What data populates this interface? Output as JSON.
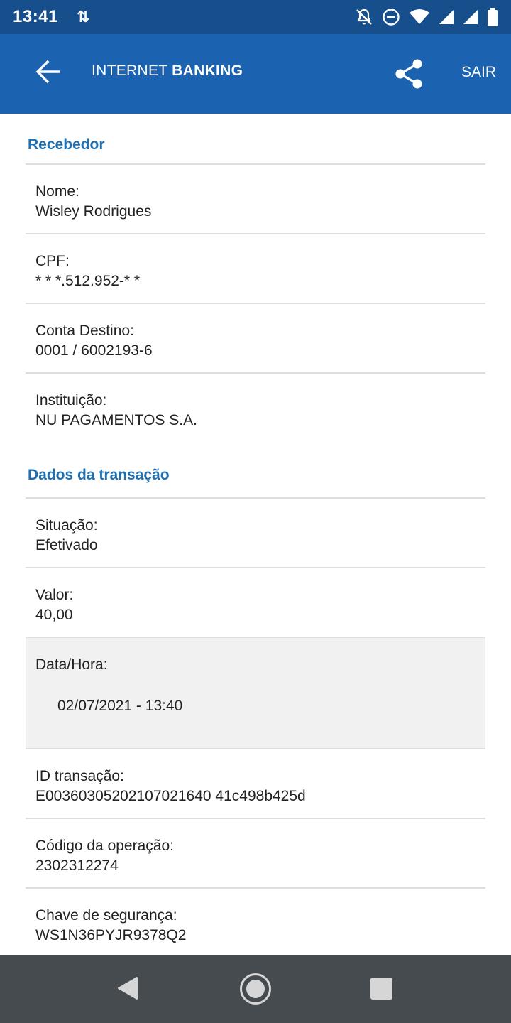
{
  "status_bar": {
    "time": "13:41",
    "data_indicator": "⇅"
  },
  "header": {
    "title_regular": "INTERNET",
    "title_bold": "BANKING",
    "exit_label": "SAIR",
    "back_icon": "arrow-back-icon",
    "share_icon": "share-icon"
  },
  "colors": {
    "status_bar": "#174f8c",
    "app_bar": "#1b62b0",
    "section_title": "#1f6fb3",
    "highlight_row": "#f2f1f1",
    "nav_bar": "#464b50"
  },
  "receiver": {
    "title": "Recebedor",
    "rows": [
      {
        "label": "Nome:",
        "value": "Wisley Rodrigues"
      },
      {
        "label": "CPF:",
        "value": "* * *.512.952-* *"
      },
      {
        "label": "Conta Destino:",
        "value": "0001 / 6002193-6"
      },
      {
        "label": "Instituição:",
        "value": "NU PAGAMENTOS S.A."
      }
    ]
  },
  "transaction": {
    "title": "Dados da transação",
    "rows": [
      {
        "label": "Situação:",
        "value": "Efetivado"
      },
      {
        "label": "Valor:",
        "value": "40,00"
      },
      {
        "label": "Data/Hora:",
        "value": "02/07/2021 - 13:40"
      },
      {
        "label": "ID transação:",
        "value": "E00360305202107021640 41c498b425d"
      },
      {
        "label": "Código da operação:",
        "value": "2302312274"
      },
      {
        "label": "Chave de segurança:",
        "value": "WS1N36PYJR9378Q2"
      }
    ]
  }
}
